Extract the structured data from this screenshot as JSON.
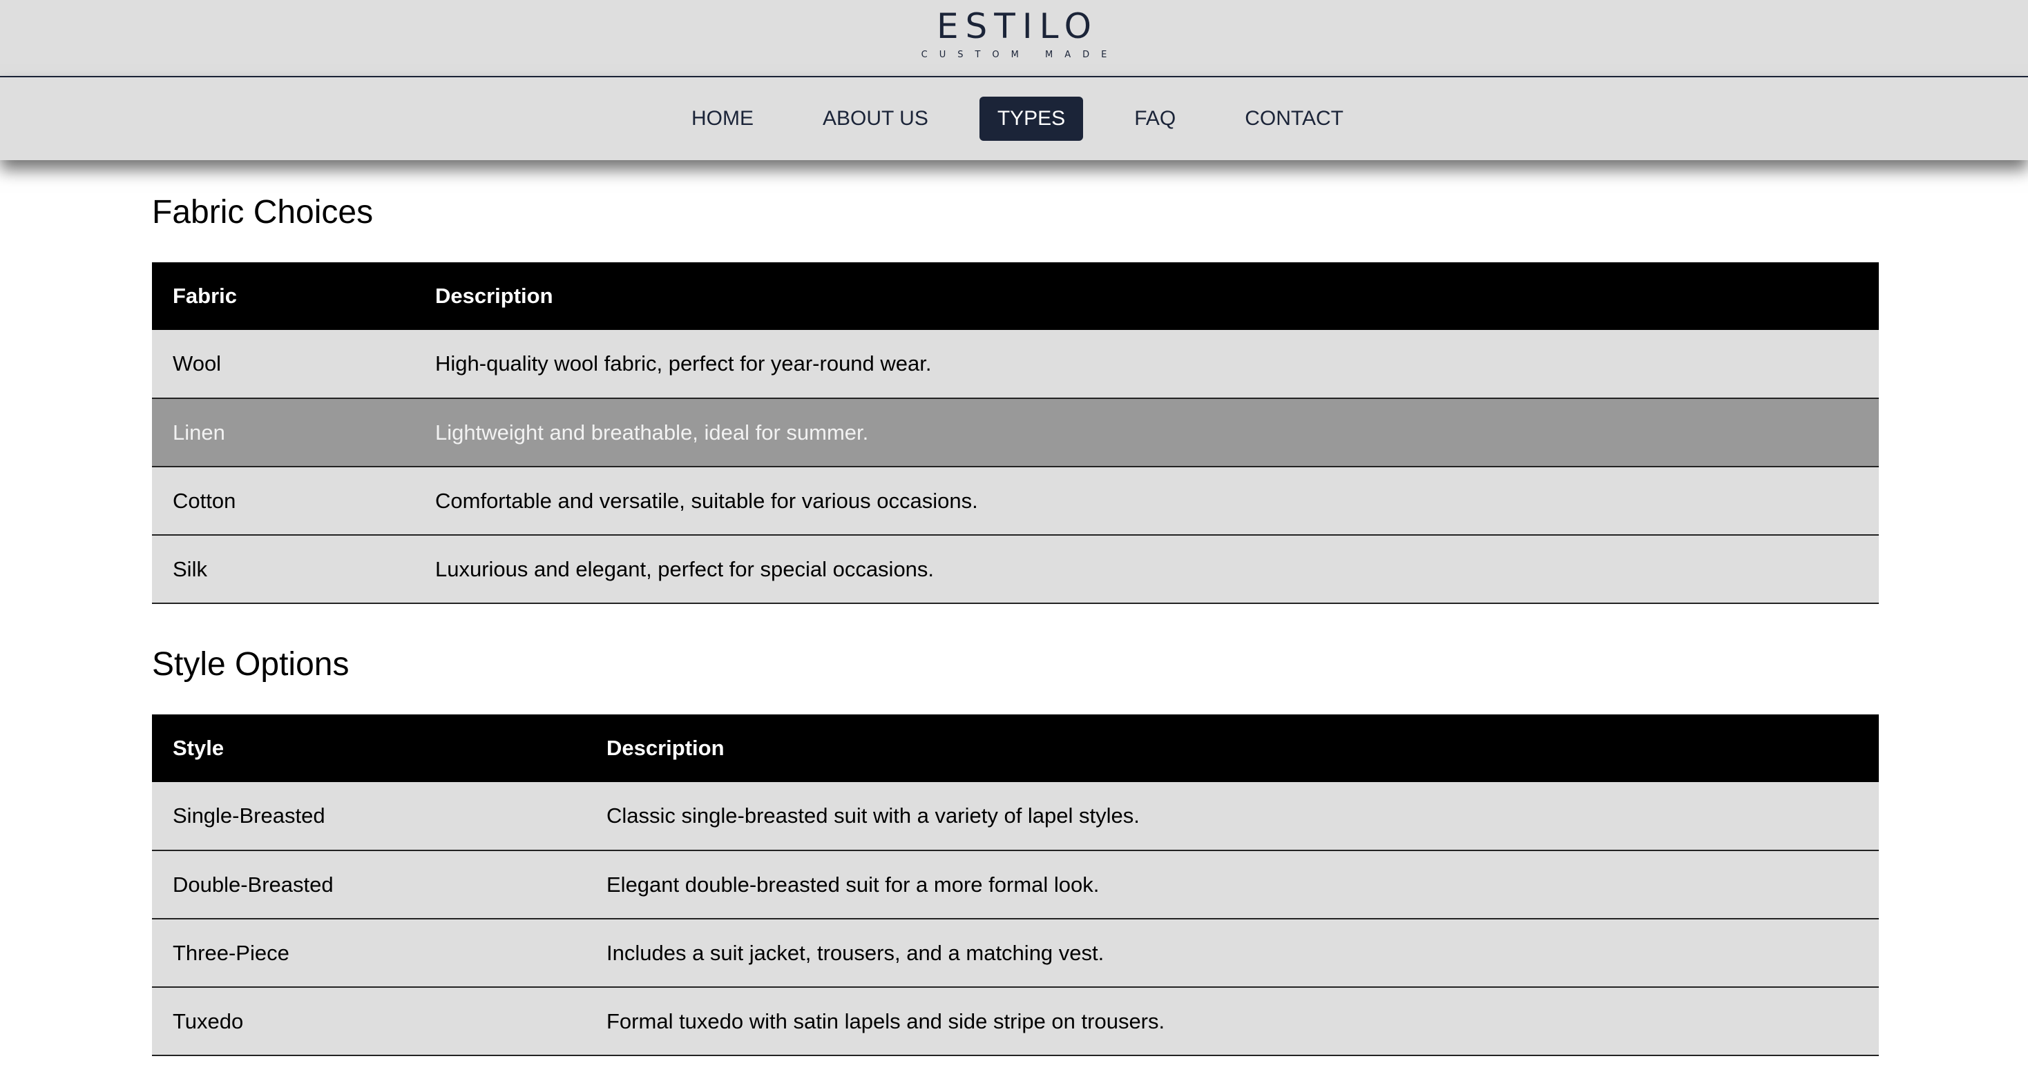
{
  "brand": {
    "name": "ESTILO",
    "tagline": "CUSTOM MADE"
  },
  "nav": {
    "items": [
      {
        "label": "HOME",
        "active": false
      },
      {
        "label": "ABOUT US",
        "active": false
      },
      {
        "label": "TYPES",
        "active": true
      },
      {
        "label": "FAQ",
        "active": false
      },
      {
        "label": "CONTACT",
        "active": false
      }
    ]
  },
  "colors": {
    "header_bg": "#dedede",
    "accent": "#1b2438",
    "table_header_bg": "#000000",
    "row_bg": "#dedede",
    "row_highlight_bg": "#999999"
  },
  "fabric_section": {
    "title": "Fabric Choices",
    "headers": [
      "Fabric",
      "Description"
    ],
    "rows": [
      {
        "name": "Wool",
        "description": "High-quality wool fabric, perfect for year-round wear."
      },
      {
        "name": "Linen",
        "description": "Lightweight and breathable, ideal for summer.",
        "highlighted": true
      },
      {
        "name": "Cotton",
        "description": "Comfortable and versatile, suitable for various occasions."
      },
      {
        "name": "Silk",
        "description": "Luxurious and elegant, perfect for special occasions."
      }
    ]
  },
  "style_section": {
    "title": "Style Options",
    "headers": [
      "Style",
      "Description"
    ],
    "rows": [
      {
        "name": "Single-Breasted",
        "description": "Classic single-breasted suit with a variety of lapel styles."
      },
      {
        "name": "Double-Breasted",
        "description": "Elegant double-breasted suit for a more formal look."
      },
      {
        "name": "Three-Piece",
        "description": "Includes a suit jacket, trousers, and a matching vest."
      },
      {
        "name": "Tuxedo",
        "description": "Formal tuxedo with satin lapels and side stripe on trousers."
      }
    ]
  }
}
